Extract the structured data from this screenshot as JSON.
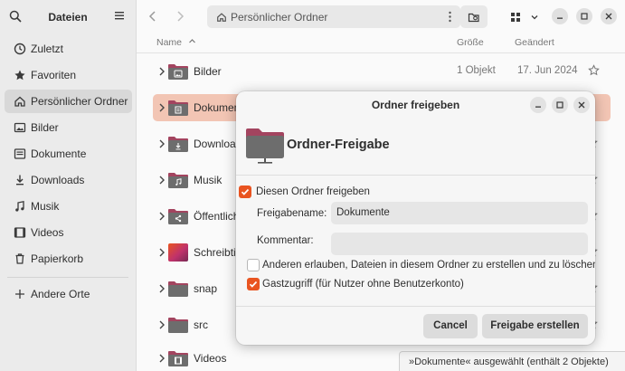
{
  "sidebar": {
    "title": "Dateien",
    "items": [
      {
        "label": "Zuletzt",
        "icon": "clock-icon"
      },
      {
        "label": "Favoriten",
        "icon": "star-icon"
      },
      {
        "label": "Persönlicher Ordner",
        "icon": "home-icon"
      },
      {
        "label": "Bilder",
        "icon": "image-icon"
      },
      {
        "label": "Dokumente",
        "icon": "document-icon"
      },
      {
        "label": "Downloads",
        "icon": "download-icon"
      },
      {
        "label": "Musik",
        "icon": "music-icon"
      },
      {
        "label": "Videos",
        "icon": "video-icon"
      },
      {
        "label": "Papierkorb",
        "icon": "trash-icon"
      }
    ],
    "other_locations": "Andere Orte",
    "active_item": "Persönlicher Ordner"
  },
  "toolbar": {
    "path": "Persönlicher Ordner"
  },
  "columns": {
    "name": "Name",
    "size": "Größe",
    "modified": "Geändert"
  },
  "files": [
    {
      "name": "Bilder",
      "size": "1 Objekt",
      "modified": "17. Jun 2024",
      "icon": "image-icon"
    },
    {
      "name": "Dokumente",
      "size": "",
      "modified": "",
      "icon": "document-icon"
    },
    {
      "name": "Downloads",
      "size": "",
      "modified": "",
      "icon": "download-icon"
    },
    {
      "name": "Musik",
      "size": "",
      "modified": "",
      "icon": "music-icon"
    },
    {
      "name": "Öffentlich",
      "size": "",
      "modified": "",
      "icon": "share-icon"
    },
    {
      "name": "Schreibtisch",
      "size": "",
      "modified": "",
      "icon": "desktop-icon"
    },
    {
      "name": "snap",
      "size": "",
      "modified": "",
      "icon": "folder-icon"
    },
    {
      "name": "src",
      "size": "",
      "modified": "",
      "icon": "folder-icon"
    },
    {
      "name": "Videos",
      "size": "",
      "modified": "",
      "icon": "video-icon"
    }
  ],
  "status": "»Dokumente« ausgewählt  (enthält 2 Objekte)",
  "dialog": {
    "title": "Ordner freigeben",
    "heading": "Ordner-Freigabe",
    "share_checkbox": {
      "label": "Diesen Ordner freigeben",
      "checked": true
    },
    "share_name_label": "Freigabename:",
    "share_name_value": "Dokumente",
    "comment_label": "Kommentar:",
    "comment_value": "",
    "allow_others": {
      "label": "Anderen erlauben, Dateien in diesem Ordner zu erstellen und zu löschen",
      "checked": false
    },
    "guest_access": {
      "label": "Gastzugriff (für Nutzer ohne Benutzerkonto)",
      "checked": true
    },
    "cancel_label": "Cancel",
    "create_label": "Freigabe erstellen"
  },
  "colors": {
    "accent": "#e95420",
    "selection": "#f2c5b4",
    "folder_top": "#a3445f",
    "folder_body": "#6d6d6d"
  }
}
